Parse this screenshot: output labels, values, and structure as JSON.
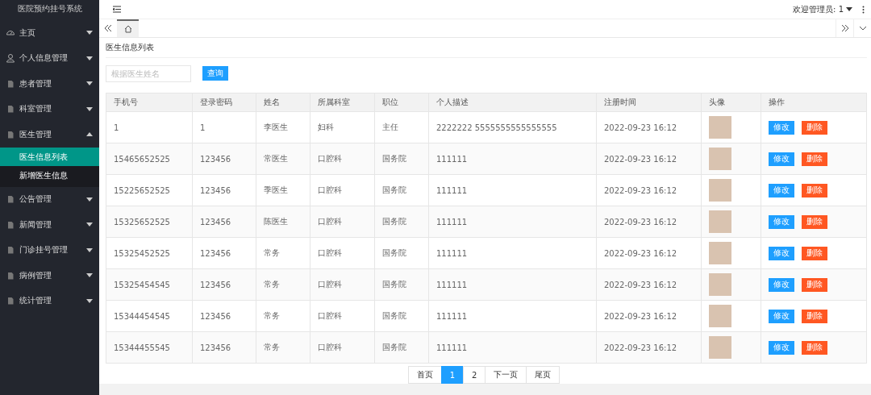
{
  "sidebar": {
    "title": "医院预约挂号系统",
    "items": [
      {
        "label": "主页",
        "kind": "gauge",
        "expanded": false
      },
      {
        "label": "个人信息管理",
        "kind": "user",
        "expanded": false
      },
      {
        "label": "患者管理",
        "kind": "doc",
        "expanded": false
      },
      {
        "label": "科室管理",
        "kind": "doc",
        "expanded": false
      },
      {
        "label": "医生管理",
        "kind": "doc",
        "expanded": true,
        "children": [
          {
            "label": "医生信息列表",
            "selected": true
          },
          {
            "label": "新增医生信息",
            "selected": false
          }
        ]
      },
      {
        "label": "公告管理",
        "kind": "doc",
        "expanded": false
      },
      {
        "label": "新闻管理",
        "kind": "doc",
        "expanded": false
      },
      {
        "label": "门诊挂号管理",
        "kind": "doc",
        "expanded": false
      },
      {
        "label": "病例管理",
        "kind": "doc",
        "expanded": false
      },
      {
        "label": "统计管理",
        "kind": "doc",
        "expanded": false
      }
    ]
  },
  "header": {
    "user": "欢迎管理员: 1"
  },
  "tabs": [
    {
      "kind": "home",
      "selected": true
    }
  ],
  "page_title": "医生信息列表",
  "search": {
    "placeholder": "根据医生姓名",
    "button": "查询"
  },
  "table": {
    "columns": [
      "手机号",
      "登录密码",
      "姓名",
      "所属科室",
      "职位",
      "个人描述",
      "注册时间",
      "头像",
      "操作"
    ],
    "rows": [
      {
        "cells": [
          "1",
          "1",
          "李医生",
          "妇科",
          "主任",
          "2222222 5555555555555555",
          "2022-09-23 16:12"
        ],
        "actions": [
          "修改",
          "删除"
        ]
      },
      {
        "cells": [
          "15465652525",
          "123456",
          "常医生",
          "口腔科",
          "国务院",
          "111111",
          "2022-09-23 16:12"
        ],
        "actions": [
          "修改",
          "删除"
        ]
      },
      {
        "cells": [
          "15225652525",
          "123456",
          "季医生",
          "口腔科",
          "国务院",
          "111111",
          "2022-09-23 16:12"
        ],
        "actions": [
          "修改",
          "删除"
        ]
      },
      {
        "cells": [
          "15325652525",
          "123456",
          "陈医生",
          "口腔科",
          "国务院",
          "111111",
          "2022-09-23 16:12"
        ],
        "actions": [
          "修改",
          "删除"
        ]
      },
      {
        "cells": [
          "15325452525",
          "123456",
          "常务",
          "口腔科",
          "国务院",
          "111111",
          "2022-09-23 16:12"
        ],
        "actions": [
          "修改",
          "删除"
        ]
      },
      {
        "cells": [
          "15325454545",
          "123456",
          "常务",
          "口腔科",
          "国务院",
          "111111",
          "2022-09-23 16:12"
        ],
        "actions": [
          "修改",
          "删除"
        ]
      },
      {
        "cells": [
          "15344454545",
          "123456",
          "常务",
          "口腔科",
          "国务院",
          "111111",
          "2022-09-23 16:12"
        ],
        "actions": [
          "修改",
          "删除"
        ]
      },
      {
        "cells": [
          "15344455545",
          "123456",
          "常务",
          "口腔科",
          "国务院",
          "111111",
          "2022-09-23 16:12"
        ],
        "actions": [
          "修改",
          "删除"
        ]
      }
    ]
  },
  "pagination": [
    {
      "label": "首页",
      "selected": false
    },
    {
      "label": "1",
      "selected": true
    },
    {
      "label": "2",
      "selected": false
    },
    {
      "label": "下一页",
      "selected": false
    },
    {
      "label": "尾页",
      "selected": false
    }
  ]
}
